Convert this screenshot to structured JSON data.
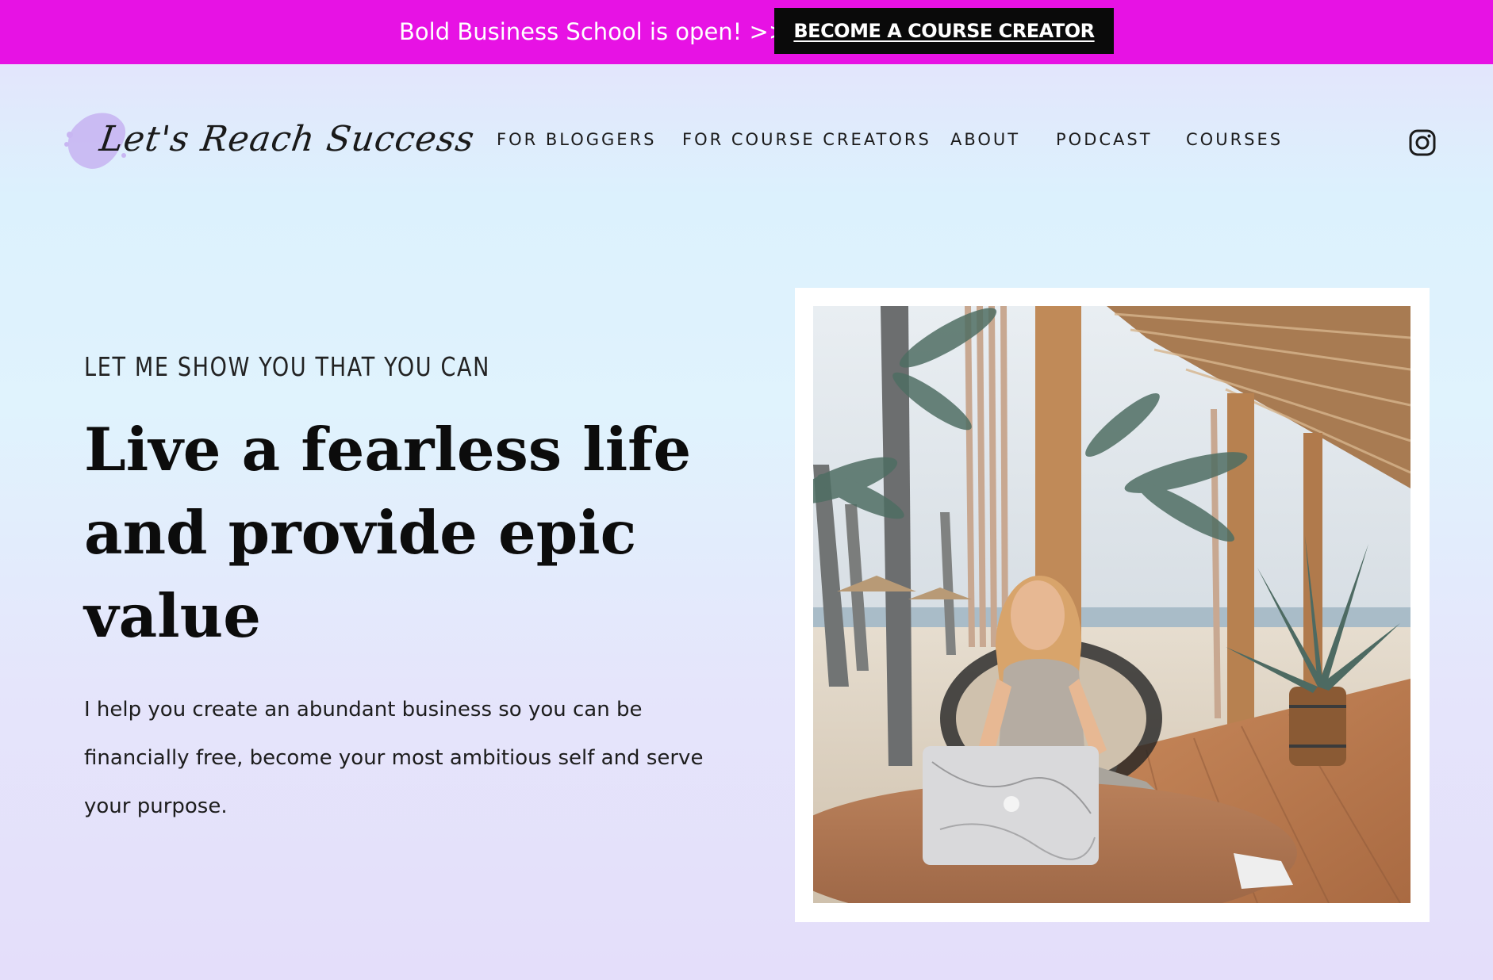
{
  "announcement": {
    "text": "Bold Business School is open! >>",
    "button_label": "BECOME A COURSE CREATOR"
  },
  "header": {
    "logo_text": "Let's Reach Success",
    "nav": [
      {
        "label": "FOR BLOGGERS"
      },
      {
        "label": "FOR COURSE CREATORS"
      },
      {
        "label": "ABOUT"
      },
      {
        "label": "PODCAST"
      },
      {
        "label": "COURSES"
      }
    ],
    "social_icon": "instagram-icon"
  },
  "hero": {
    "kicker": "LET ME SHOW YOU THAT YOU CAN",
    "headline_lines": [
      "Live a fearless life",
      "and provide epic",
      "value"
    ],
    "body_lines": [
      "I help you create an abundant business so you can be",
      "financially free, become your most ambitious self and serve",
      "your purpose."
    ],
    "photo_icon": "woman-with-laptop-photo"
  },
  "colors": {
    "announcement_bg": "#e712e4",
    "button_bg": "#0a0a0a",
    "logo_blob": "#c8b6f2"
  }
}
